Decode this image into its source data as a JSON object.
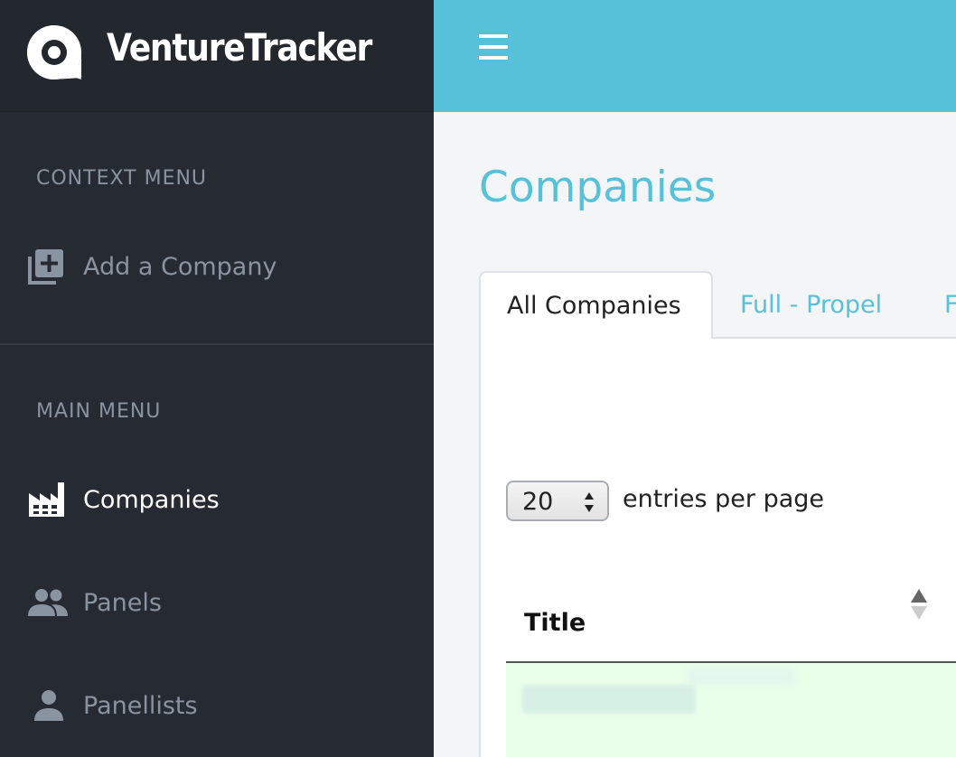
{
  "brand": {
    "name": "VentureTracker"
  },
  "sidebar": {
    "context_heading": "CONTEXT MENU",
    "context_items": [
      {
        "label": "Add a Company",
        "icon": "add-box-icon"
      }
    ],
    "main_heading": "MAIN MENU",
    "main_items": [
      {
        "label": "Companies",
        "icon": "factory-icon",
        "active": true
      },
      {
        "label": "Panels",
        "icon": "people-icon",
        "active": false
      },
      {
        "label": "Panellists",
        "icon": "person-icon",
        "active": false
      }
    ]
  },
  "page": {
    "title": "Companies"
  },
  "tabs": [
    {
      "label": "All Companies",
      "active": true
    },
    {
      "label": "Full - Propel",
      "active": false
    },
    {
      "label": "F",
      "active": false
    }
  ],
  "table": {
    "entries_per_page": "20",
    "entries_label": "entries per page",
    "columns": [
      {
        "label": "Title",
        "sortable": true
      }
    ]
  },
  "colors": {
    "accent": "#57c1d9",
    "sidebar_bg": "#262b33",
    "row_highlight": "#eaffea"
  }
}
